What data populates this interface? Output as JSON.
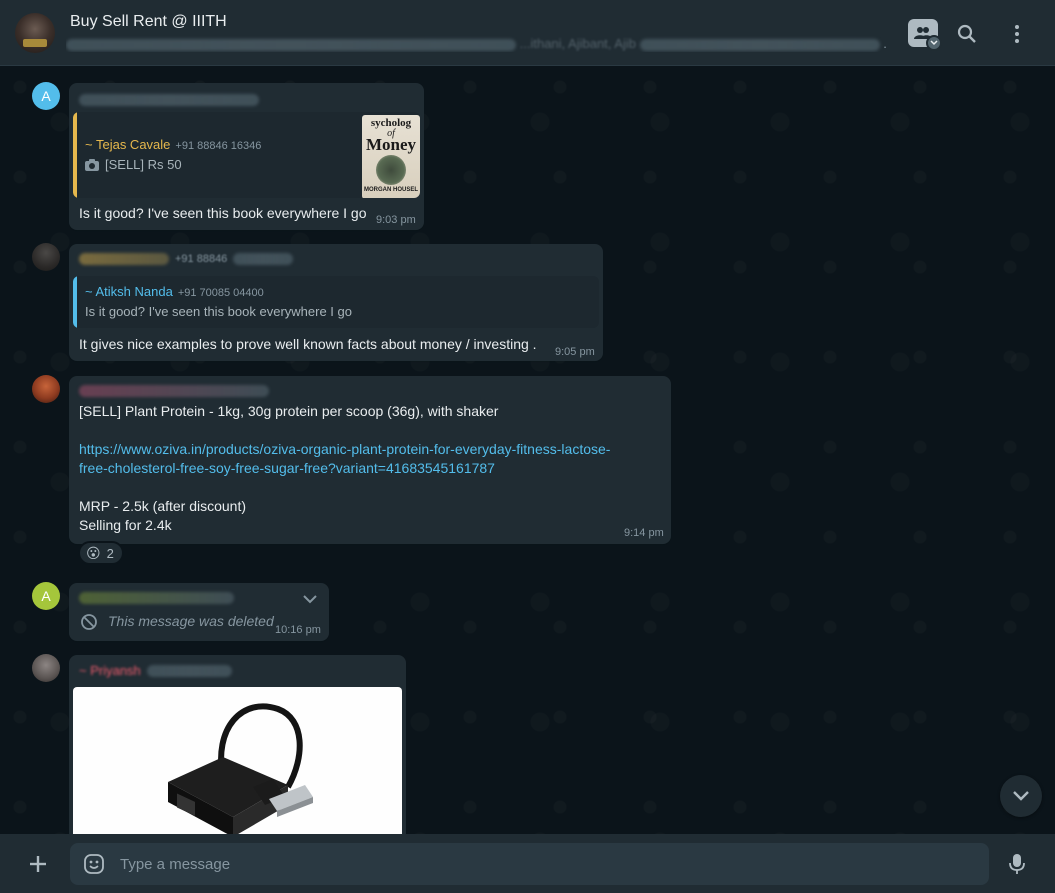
{
  "header": {
    "group_name": "Buy Sell Rent @ IIITH",
    "members_visible_fragment": "...ithani, Ajibant, Ajib",
    "members_ellipsis": ".."
  },
  "messages": [
    {
      "avatar_letter": "A",
      "avatar_color": "#53bdeb",
      "quote_name": "~ Tejas Cavale",
      "quote_phone": "+91 88846 16346",
      "quote_text": "[SELL] Rs 50",
      "book_lines": [
        "sycholog",
        "of",
        "Money",
        "MORGAN HOUSEL"
      ],
      "text": "Is it good? I've seen this book everywhere I go",
      "time": "9:03 pm"
    },
    {
      "sender_phone_partial": "+91 88846",
      "quote_name": "~ Atiksh Nanda",
      "quote_phone": "+91 70085 04400",
      "quote_text": "Is it good? I've seen this book everywhere I go",
      "text": "It gives nice examples to prove well known facts about money / investing .",
      "time": "9:05 pm"
    },
    {
      "lines": [
        "[SELL] Plant Protein - 1kg, 30g protein per scoop (36g), with shaker",
        "",
        "MRP - 2.5k (after discount)",
        "Selling for 2.4k"
      ],
      "link_line1": "https://www.oziva.in/products/oziva-organic-plant-protein-for-everyday-fitness-lactose-",
      "link_line2": "free-cholesterol-free-soy-free-sugar-free?variant=41683545161787",
      "time": "9:14 pm",
      "reaction_emoji": "😮",
      "reaction_count": "2"
    },
    {
      "avatar_letter": "A",
      "avatar_color": "#a5c63b",
      "deleted_text": "This message was deleted",
      "time": "10:16 pm"
    },
    {
      "sender_fragment": "~ Priyansh"
    }
  ],
  "composer": {
    "placeholder": "Type a message"
  },
  "colors": {
    "header_bg": "#202c33",
    "chat_bg": "#0b141a",
    "bubble_bg": "#202c33",
    "quote_orange": "#e6b84d",
    "quote_blue": "#53bdeb",
    "link": "#53bdeb"
  },
  "icons": [
    "community-icon",
    "search-icon",
    "menu-icon",
    "camera-icon",
    "deleted-icon",
    "chevron-down-icon",
    "plus-icon",
    "emoji-icon",
    "mic-icon"
  ]
}
